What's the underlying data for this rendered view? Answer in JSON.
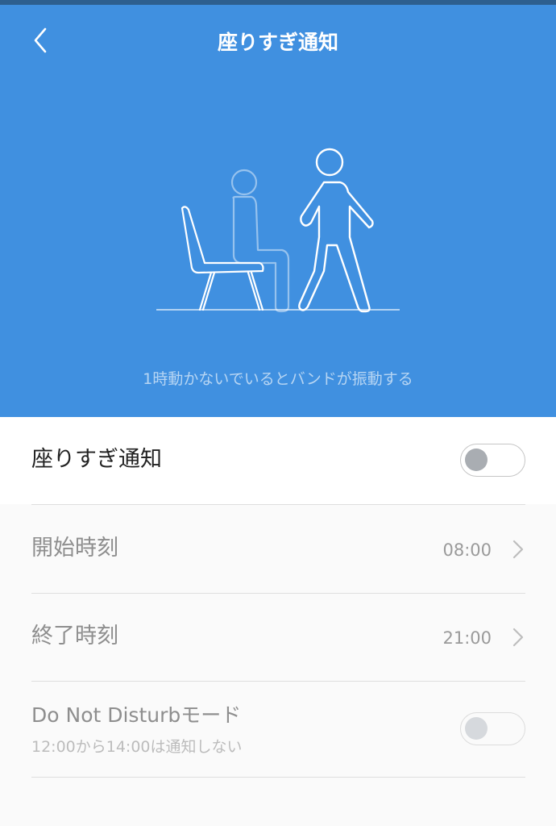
{
  "header": {
    "title": "座りすぎ通知",
    "caption": "1時動かないでいるとバンドが振動する"
  },
  "settings": {
    "main_toggle": {
      "label": "座りすぎ通知",
      "enabled": false
    },
    "start_time": {
      "label": "開始時刻",
      "value": "08:00"
    },
    "end_time": {
      "label": "終了時刻",
      "value": "21:00"
    },
    "dnd": {
      "label": "Do Not Disturbモード",
      "sublabel": "12:00から14:00は通知しない",
      "enabled": false
    }
  },
  "colors": {
    "header_bg": "#4090e0",
    "status_bar": "#2d5f8f",
    "page_bg": "#fafafa"
  },
  "icons": {
    "back": "chevron-left-icon",
    "row_arrow": "chevron-right-icon",
    "illustration": "sitting-walking-person-icon"
  }
}
